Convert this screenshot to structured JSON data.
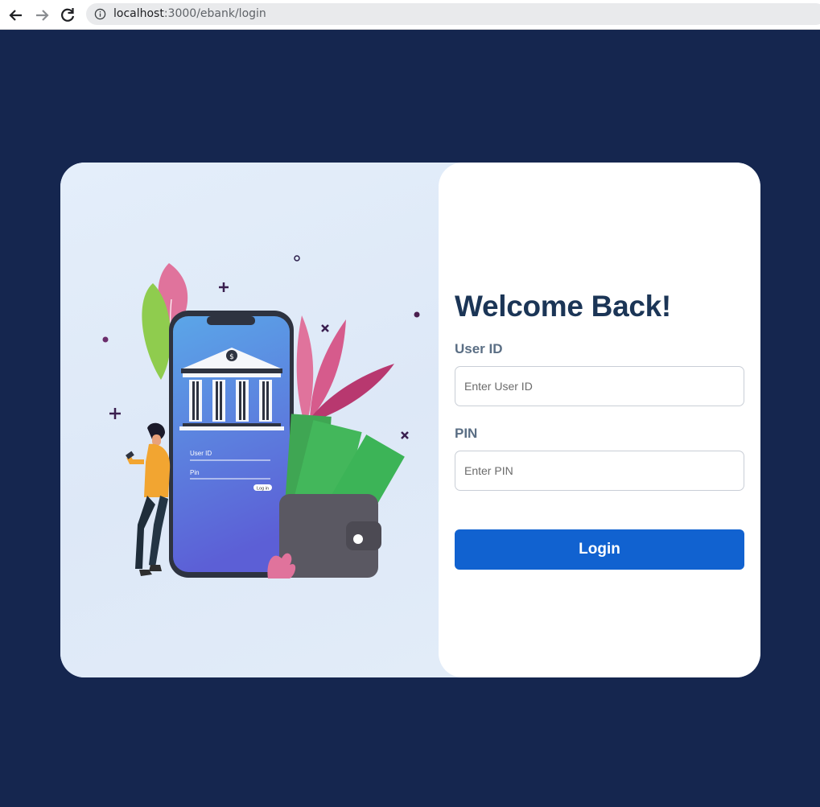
{
  "browser": {
    "url_host": "localhost",
    "url_path": ":3000/ebank/login"
  },
  "illustration": {
    "phone_user_id_label": "User ID",
    "phone_pin_label": "Pin",
    "phone_login_label": "Log in"
  },
  "login": {
    "title": "Welcome Back!",
    "user_id_label": "User ID",
    "user_id_placeholder": "Enter User ID",
    "user_id_value": "",
    "pin_label": "PIN",
    "pin_placeholder": "Enter PIN",
    "pin_value": "",
    "submit_label": "Login"
  },
  "colors": {
    "page_background": "#15264f",
    "title": "#1b3556",
    "label": "#5a6e84",
    "button": "#1162d0"
  }
}
